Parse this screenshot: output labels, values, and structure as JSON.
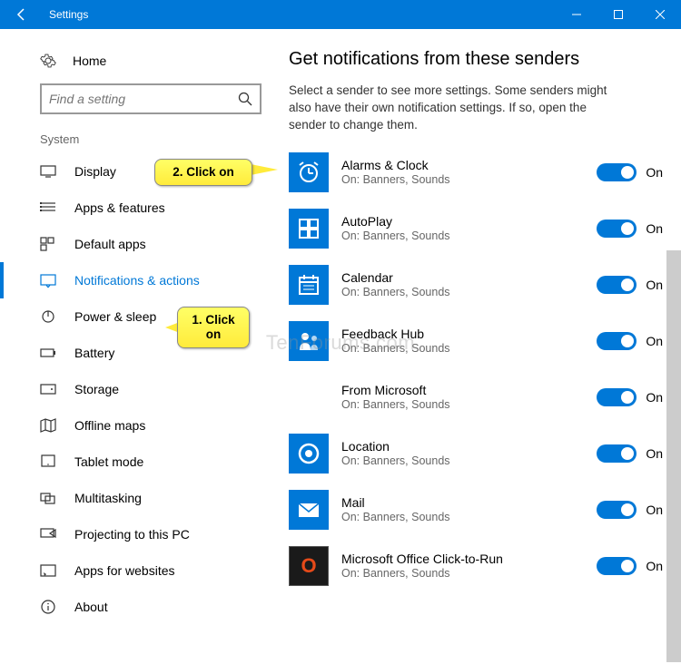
{
  "titlebar": {
    "title": "Settings"
  },
  "sidebar": {
    "home": "Home",
    "search_placeholder": "Find a setting",
    "section": "System",
    "items": [
      {
        "label": "Display",
        "icon": "display"
      },
      {
        "label": "Apps & features",
        "icon": "apps"
      },
      {
        "label": "Default apps",
        "icon": "default-apps"
      },
      {
        "label": "Notifications & actions",
        "icon": "notifications",
        "active": true
      },
      {
        "label": "Power & sleep",
        "icon": "power"
      },
      {
        "label": "Battery",
        "icon": "battery"
      },
      {
        "label": "Storage",
        "icon": "storage"
      },
      {
        "label": "Offline maps",
        "icon": "maps"
      },
      {
        "label": "Tablet mode",
        "icon": "tablet"
      },
      {
        "label": "Multitasking",
        "icon": "multitasking"
      },
      {
        "label": "Projecting to this PC",
        "icon": "projecting"
      },
      {
        "label": "Apps for websites",
        "icon": "apps-web"
      },
      {
        "label": "About",
        "icon": "about"
      }
    ]
  },
  "main": {
    "heading": "Get notifications from these senders",
    "subtitle": "Select a sender to see more settings. Some senders might also have their own notification settings. If so, open the sender to change them.",
    "senders": [
      {
        "name": "Alarms & Clock",
        "status": "On: Banners, Sounds",
        "toggle": "On",
        "icon": "alarm"
      },
      {
        "name": "AutoPlay",
        "status": "On: Banners, Sounds",
        "toggle": "On",
        "icon": "autoplay"
      },
      {
        "name": "Calendar",
        "status": "On: Banners, Sounds",
        "toggle": "On",
        "icon": "calendar"
      },
      {
        "name": "Feedback Hub",
        "status": "On: Banners, Sounds",
        "toggle": "On",
        "icon": "feedback"
      },
      {
        "name": "From Microsoft",
        "status": "On: Banners, Sounds",
        "toggle": "On",
        "icon": "microsoft"
      },
      {
        "name": "Location",
        "status": "On: Banners, Sounds",
        "toggle": "On",
        "icon": "location"
      },
      {
        "name": "Mail",
        "status": "On: Banners, Sounds",
        "toggle": "On",
        "icon": "mail"
      },
      {
        "name": "Microsoft Office Click-to-Run",
        "status": "On: Banners, Sounds",
        "toggle": "On",
        "icon": "office"
      }
    ]
  },
  "callouts": {
    "c1": "1. Click on",
    "c2": "2. Click on"
  },
  "watermark": "TenForums.com"
}
